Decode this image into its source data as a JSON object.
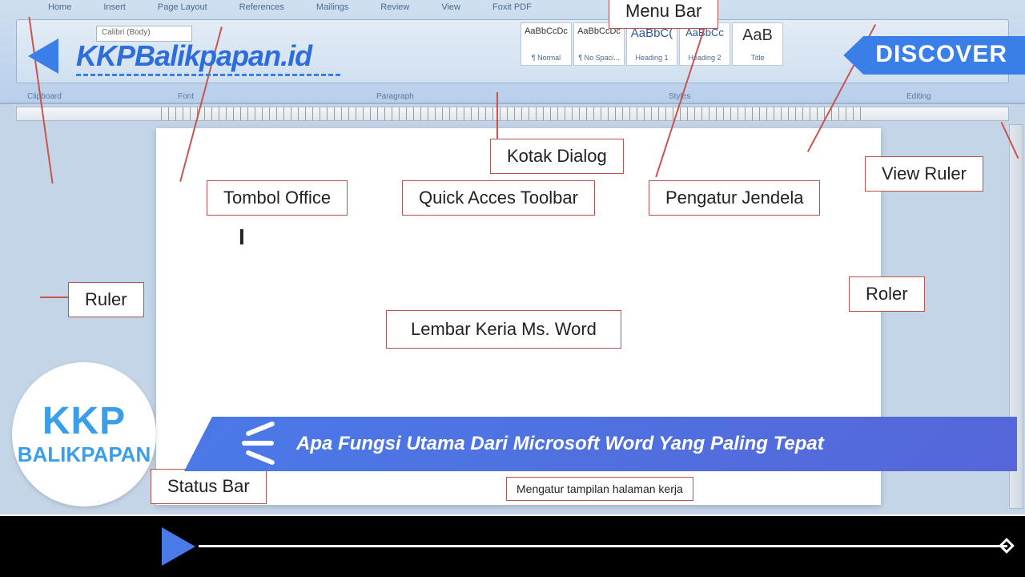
{
  "site": {
    "logo_text": "KKPBalikpapan.id",
    "discover": "DISCOVER",
    "circle_top": "KKP",
    "circle_bottom": "BALIKPAPAN"
  },
  "article": {
    "title": "Apa Fungsi Utama Dari Microsoft Word Yang Paling Tepat"
  },
  "word_ui": {
    "tabs": [
      "Home",
      "Insert",
      "Page Layout",
      "References",
      "Mailings",
      "Review",
      "View",
      "Foxit PDF"
    ],
    "groups": {
      "clipboard": "Clipboard",
      "font": "Font",
      "paragraph": "Paragraph",
      "styles": "Styles",
      "editing": "Editing"
    },
    "font_name": "Calibri (Body)",
    "styles": [
      {
        "sample": "AaBbCcDc",
        "name": "¶ Normal"
      },
      {
        "sample": "AaBbCcDc",
        "name": "¶ No Spaci..."
      },
      {
        "sample": "AaBbC(",
        "name": "Heading 1"
      },
      {
        "sample": "AaBbCc",
        "name": "Heading 2"
      },
      {
        "sample": "AaB",
        "name": "Title"
      }
    ]
  },
  "labels": {
    "menu_bar": "Menu Bar",
    "kotak_dialog": "Kotak Dialog",
    "tombol_office": "Tombol Office",
    "quick_access": "Quick Acces Toolbar",
    "pengatur_jendela": "Pengatur Jendela",
    "view_ruler": "View Ruler",
    "ruler": "Ruler",
    "roler": "Roler",
    "lembar_kerja": "Lembar Keria Ms. Word",
    "status_bar": "Status Bar",
    "mengatur": "Mengatur tampilan halaman kerja"
  }
}
